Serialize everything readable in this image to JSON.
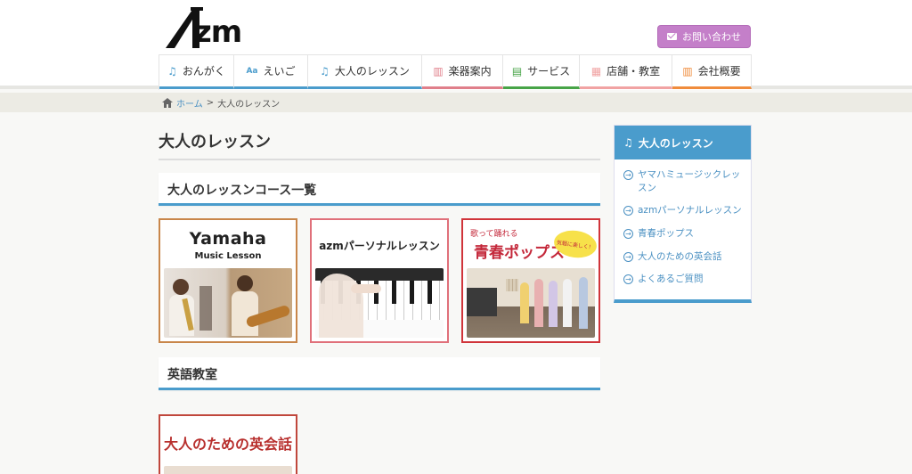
{
  "header": {
    "logo_text": "zm",
    "contact_label": "お問い合わせ"
  },
  "nav": [
    {
      "label": "おんがく",
      "icon": "♫",
      "color": "#4a9ccc"
    },
    {
      "label": "えいご",
      "icon": "Aa",
      "color": "#4a9ccc"
    },
    {
      "label": "大人のレッスン",
      "icon": "♫",
      "color": "#4a9ccc"
    },
    {
      "label": "楽器案内",
      "icon": "▥",
      "color": "#e07f8a"
    },
    {
      "label": "サービス",
      "icon": "▤",
      "color": "#47a447"
    },
    {
      "label": "店舗・教室",
      "icon": "▦",
      "color": "#f1a3a3"
    },
    {
      "label": "会社概要",
      "icon": "▥",
      "color": "#f08c3c"
    }
  ],
  "breadcrumb": {
    "home": "ホーム",
    "sep": ">",
    "current": "大人のレッスン"
  },
  "main": {
    "title": "大人のレッスン",
    "section1": "大人のレッスンコース一覧",
    "section2": "英語教室",
    "cards": [
      {
        "title": "Yamaha",
        "subtitle": "Music Lesson",
        "border": "#c8864a"
      },
      {
        "title": "azmパーソナルレッスン",
        "border": "#e0707a"
      },
      {
        "title": "青春ポップス",
        "small": "歌って踊れる",
        "badge": "気軽に楽しく！",
        "border": "#d0343a"
      }
    ],
    "eikaiwa_card": {
      "title": "大人のための英会話",
      "border": "#c0473c"
    }
  },
  "sidebar": {
    "head": "大人のレッスン",
    "items": [
      "ヤマハミュージックレッスン",
      "azmパーソナルレッスン",
      "青春ポップス",
      "大人のための英会話",
      "よくあるご質問"
    ]
  }
}
